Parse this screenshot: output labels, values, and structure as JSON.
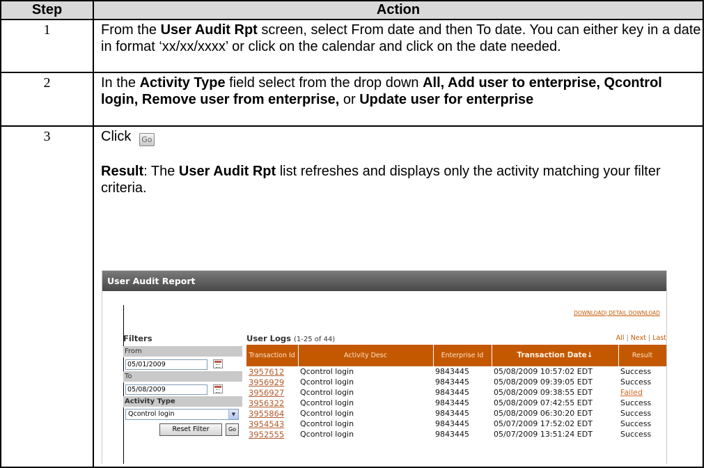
{
  "table": {
    "header_step": "Step",
    "header_action": "Action",
    "rows": [
      {
        "step": "1",
        "text_a": "From the ",
        "bold_a": "User Audit Rpt",
        "text_b": " screen, select From date and then To date. You can either key in a date in format ‘xx/xx/xxxx’ or click on the calendar and click on the date needed."
      },
      {
        "step": "2",
        "text_a": "In the ",
        "bold_a": "Activity Type",
        "text_b": " field select from the drop down ",
        "bold_b": "All, Add user to enterprise, Qcontrol login, Remove user from enterprise,",
        "text_c": " or ",
        "bold_c": "Update user for enterprise"
      },
      {
        "step": "3",
        "click_label": "Click ",
        "go_icon_text": "Go",
        "result_label": "Result",
        "text_a": ":  The ",
        "bold_a": "User Audit Rpt",
        "text_b": " list refreshes and displays only the activity matching your filter criteria."
      }
    ]
  },
  "report": {
    "title": "User Audit Report",
    "download_label": "DOWNLOAD",
    "separator": "|",
    "detail_download_label": "DETAIL DOWNLOAD",
    "filters": {
      "title": "Filters",
      "from_label": "From",
      "from_value": "05/01/2009",
      "to_label": "To",
      "to_value": "05/08/2009",
      "activity_label": "Activity Type",
      "activity_value": "Qcontrol login",
      "reset_label": "Reset Filter",
      "go_label": "Go"
    },
    "logs": {
      "title": "User Logs",
      "count": "(1-25 of 44)",
      "nav_all": "All",
      "nav_next": "Next",
      "nav_last": "Last",
      "nav_sep": "|",
      "columns": [
        "Transaction Id",
        "Activity Desc",
        "Enterprise Id",
        "Transaction Date",
        "Result"
      ],
      "sort_indicator": "↓",
      "rows": [
        [
          "3957612",
          "Qcontrol login",
          "9843445",
          "05/08/2009 10:57:02 EDT",
          "Success"
        ],
        [
          "3956929",
          "Qcontrol login",
          "9843445",
          "05/08/2009 09:39:05 EDT",
          "Success"
        ],
        [
          "3956927",
          "Qcontrol login",
          "9843445",
          "05/08/2009 09:38:55 EDT",
          "Failed"
        ],
        [
          "3956322",
          "Qcontrol login",
          "9843445",
          "05/08/2009 07:42:55 EDT",
          "Success"
        ],
        [
          "3955864",
          "Qcontrol login",
          "9843445",
          "05/08/2009 06:30:20 EDT",
          "Success"
        ],
        [
          "3954543",
          "Qcontrol login",
          "9843445",
          "05/07/2009 17:52:02 EDT",
          "Success"
        ],
        [
          "3952555",
          "Qcontrol login",
          "9843445",
          "05/07/2009 13:51:24 EDT",
          "Success"
        ]
      ]
    }
  }
}
